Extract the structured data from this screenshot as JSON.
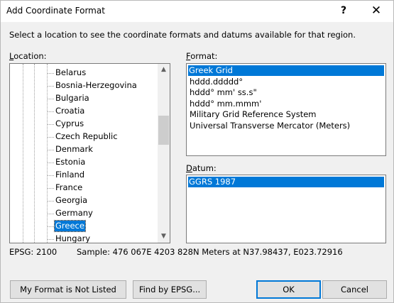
{
  "window": {
    "title": "Add Coordinate Format",
    "help_glyph": "?",
    "close_glyph": "✕"
  },
  "instructions": "Select a location to see the coordinate formats and datums available for that region.",
  "location": {
    "label_accel": "L",
    "label_rest": "ocation:",
    "items": [
      "Belarus",
      "Bosnia-Herzegovina",
      "Bulgaria",
      "Croatia",
      "Cyprus",
      "Czech Republic",
      "Denmark",
      "Estonia",
      "Finland",
      "France",
      "Georgia",
      "Germany",
      "Greece",
      "Hungary"
    ],
    "selected": "Greece",
    "scroll_up_glyph": "▲",
    "scroll_down_glyph": "▼"
  },
  "format": {
    "label_accel": "F",
    "label_rest": "ormat:",
    "items": [
      "Greek Grid",
      "hddd.ddddd°",
      "hddd° mm' ss.s\"",
      "hddd° mm.mmm'",
      "Military Grid Reference System",
      "Universal Transverse Mercator (Meters)"
    ],
    "selected": "Greek Grid"
  },
  "datum": {
    "label_accel": "D",
    "label_rest": "atum:",
    "items": [
      "GGRS 1987"
    ],
    "selected": "GGRS 1987"
  },
  "epsg_text": "EPSG: 2100",
  "sample_text": "Sample: 476 067E  4203 828N Meters at N37.98437, E023.72916",
  "buttons": {
    "not_listed": "My Format is Not Listed",
    "find_epsg": "Find by EPSG...",
    "ok": "OK",
    "cancel": "Cancel"
  },
  "colors": {
    "selection": "#0078d7",
    "window_bg": "#f0f0f0"
  }
}
